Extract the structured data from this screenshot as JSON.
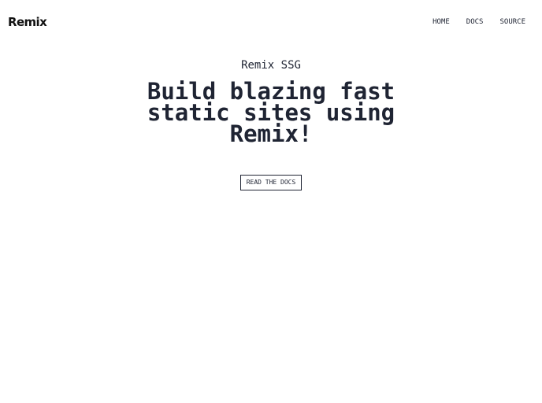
{
  "header": {
    "logo_text": "Remix",
    "nav": [
      {
        "label": "HOME"
      },
      {
        "label": "DOCS"
      },
      {
        "label": "SOURCE"
      }
    ]
  },
  "hero": {
    "eyebrow": "Remix SSG",
    "headline": "Build blazing fast static sites using Remix!",
    "cta_label": "READ THE DOCS"
  }
}
